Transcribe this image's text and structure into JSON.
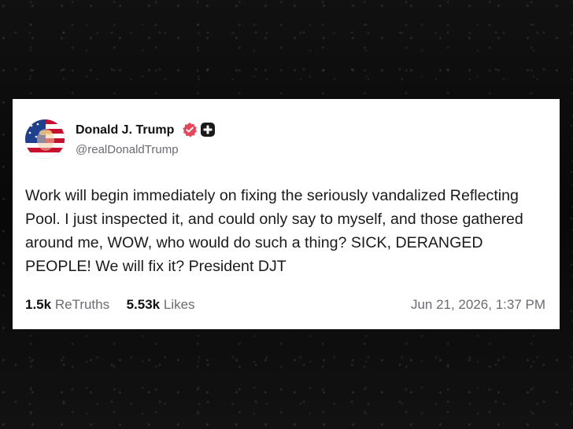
{
  "post": {
    "author_name": "Donald J. Trump",
    "handle": "@realDonaldTrump",
    "text": "Work will begin immediately on fixing the seriously vandalized Reflecting Pool. I just inspected it, and could only say to myself, and those gathered around me, WOW, who would do such a thing? SICK, DERANGED PEOPLE! We will fix it? President DJT",
    "retruths_count": "1.5k",
    "retruths_label": "ReTruths",
    "likes_count": "5.53k",
    "likes_label": "Likes",
    "timestamp": "Jun 21, 2026, 1:37 PM"
  },
  "icons": {
    "verified": "verified-badge-icon",
    "plus": "plus-badge-icon",
    "avatar": "avatar"
  },
  "colors": {
    "background": "#0b0b0b",
    "card": "#ffffff",
    "verified_badge": "#e8455a",
    "secondary_text": "#6b6b73",
    "primary_text": "#111111"
  }
}
